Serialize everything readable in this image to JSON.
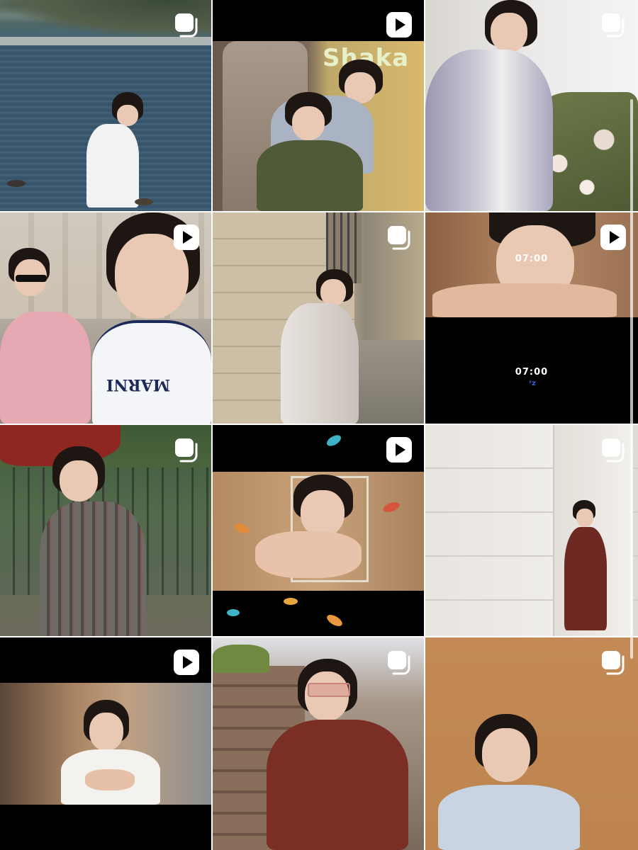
{
  "grid": {
    "tiles": [
      {
        "id": "t1",
        "type": "carousel",
        "badge_icon": "multiple-posts-icon"
      },
      {
        "id": "t2",
        "type": "video",
        "badge_icon": "play-icon",
        "sign_text": "Shaka"
      },
      {
        "id": "t3",
        "type": "carousel",
        "badge_icon": "multiple-posts-icon"
      },
      {
        "id": "t4",
        "type": "video",
        "badge_icon": "play-icon",
        "shirt_text": "MARNI"
      },
      {
        "id": "t5",
        "type": "carousel",
        "badge_icon": "multiple-posts-icon"
      },
      {
        "id": "t6",
        "type": "video",
        "badge_icon": "play-icon",
        "time_top": "07:00",
        "time_bottom": "07:00"
      },
      {
        "id": "t7",
        "type": "carousel",
        "badge_icon": "multiple-posts-icon"
      },
      {
        "id": "t8",
        "type": "video",
        "badge_icon": "play-icon"
      },
      {
        "id": "t9",
        "type": "carousel",
        "badge_icon": "multiple-posts-icon"
      },
      {
        "id": "t10",
        "type": "video",
        "badge_icon": "play-icon"
      },
      {
        "id": "t11",
        "type": "carousel",
        "badge_icon": "multiple-posts-icon"
      },
      {
        "id": "t12",
        "type": "carousel",
        "badge_icon": "multiple-posts-icon"
      }
    ]
  },
  "colors": {
    "lake": "#3e5a6e",
    "black": "#000000",
    "wall_beige": "#cbbda4",
    "orange_wall": "#c0864f",
    "badge": "#ffffff"
  }
}
